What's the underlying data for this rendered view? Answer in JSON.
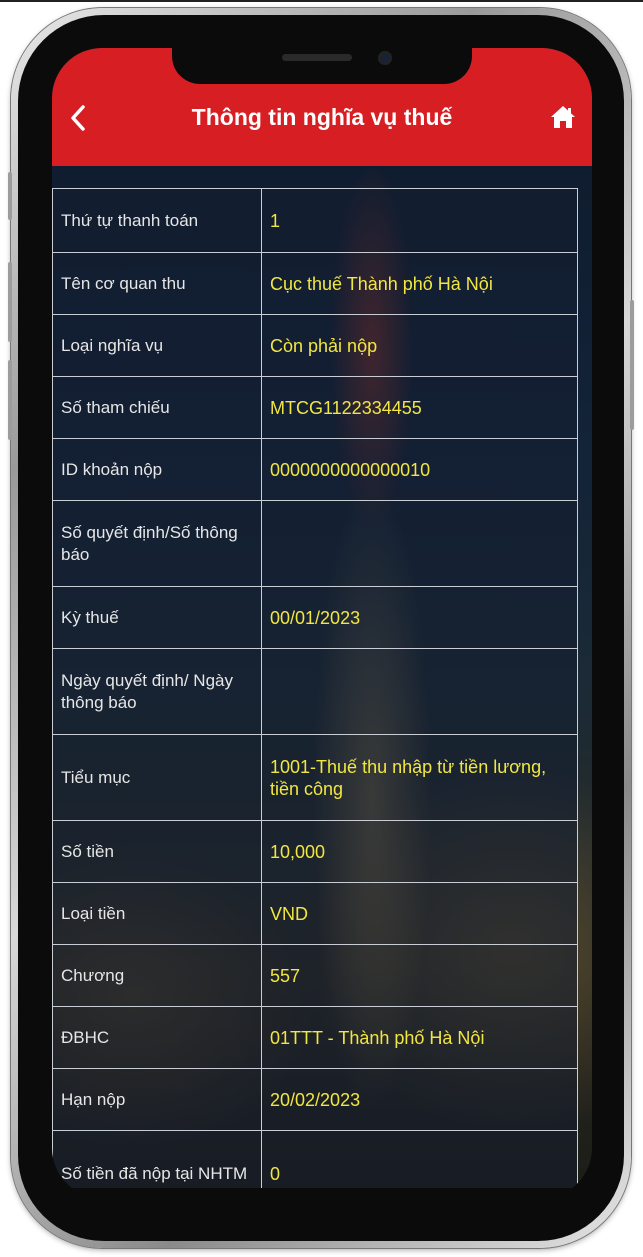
{
  "header": {
    "title": "Thông tin nghĩa vụ thuế",
    "back_icon": "chevron-left-icon",
    "home_icon": "home-icon"
  },
  "colors": {
    "header_bg": "#d71f23",
    "value_text": "#f2e640",
    "label_text": "#e6e6e6"
  },
  "rows": [
    {
      "label": "Thứ tự thanh toán",
      "value": "1"
    },
    {
      "label": "Tên cơ quan thu",
      "value": "Cục thuế Thành phố Hà Nội"
    },
    {
      "label": "Loại nghĩa vụ",
      "value": "Còn phải nộp"
    },
    {
      "label": "Số tham chiếu",
      "value": "MTCG1122334455"
    },
    {
      "label": "ID khoản nộp",
      "value": "0000000000000010"
    },
    {
      "label": "Số quyết định/Số thông báo",
      "value": ""
    },
    {
      "label": "Kỳ thuế",
      "value": "00/01/2023"
    },
    {
      "label": "Ngày quyết định/ Ngày thông báo",
      "value": ""
    },
    {
      "label": "Tiểu mục",
      "value": "1001-Thuế thu nhập từ tiền lương, tiền công"
    },
    {
      "label": "Số tiền",
      "value": "10,000"
    },
    {
      "label": "Loại tiền",
      "value": "VND"
    },
    {
      "label": "Chương",
      "value": "557"
    },
    {
      "label": "ĐBHC",
      "value": "01TTT - Thành phố Hà Nội"
    },
    {
      "label": "Hạn nộp",
      "value": "20/02/2023"
    },
    {
      "label": "Số tiền đã nộp tại NHTM",
      "value": "0"
    }
  ]
}
